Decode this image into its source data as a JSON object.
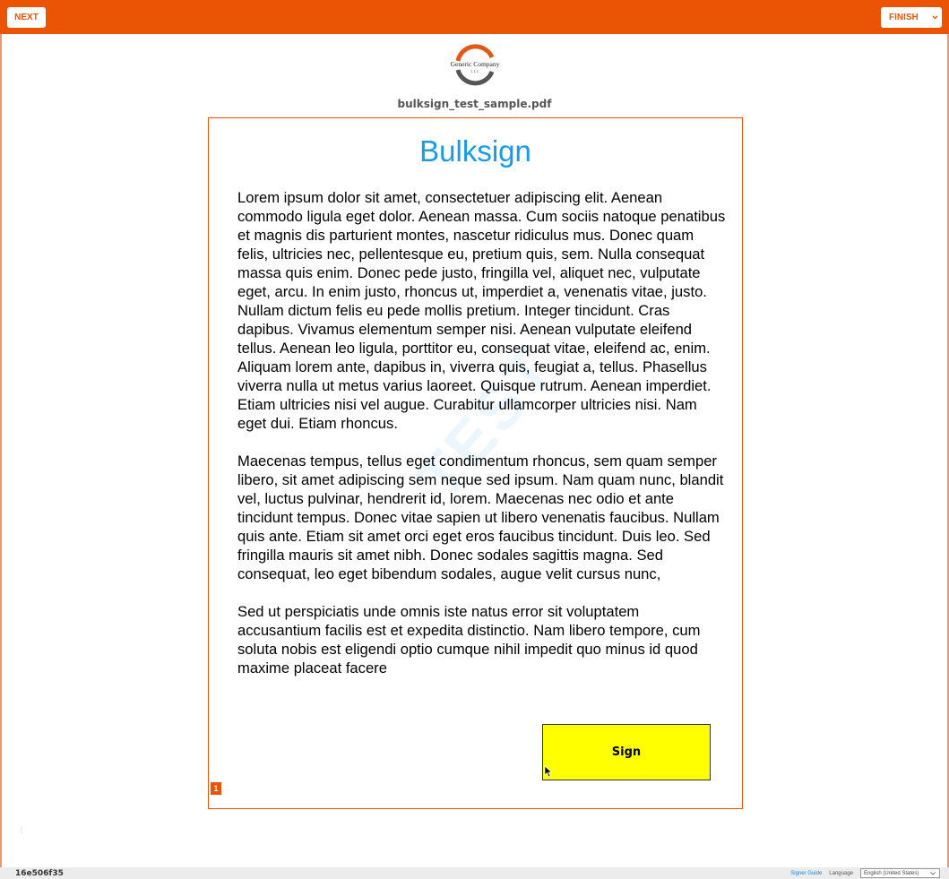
{
  "toolbar": {
    "next_label": "NEXT",
    "finish_label": "FINISH",
    "accent_color": "#ea5404"
  },
  "logo": {
    "text_line1": "Generic Company",
    "text_line2": "L L C"
  },
  "document": {
    "filename": "bulksign_test_sample.pdf",
    "title": "Bulksign",
    "paragraphs": [
      "Lorem ipsum dolor sit amet, consectetuer adipiscing elit. Aenean commodo ligula eget dolor. Aenean massa. Cum sociis natoque penatibus et magnis dis parturient montes, nascetur ridiculus mus. Donec quam felis, ultricies nec, pellentesque eu, pretium quis, sem. Nulla consequat massa quis enim. Donec pede justo, fringilla vel, aliquet nec, vulputate eget, arcu. In enim justo, rhoncus ut, imperdiet a, venenatis vitae, justo. Nullam dictum felis eu pede mollis pretium. Integer tincidunt. Cras dapibus. Vivamus elementum semper nisi. Aenean vulputate eleifend tellus. Aenean leo ligula, porttitor eu, consequat vitae, eleifend ac, enim. Aliquam lorem ante, dapibus in, viverra quis, feugiat a, tellus. Phasellus viverra nulla ut metus varius laoreet. Quisque rutrum. Aenean imperdiet. Etiam ultricies nisi vel augue. Curabitur ullamcorper ultricies nisi. Nam eget dui. Etiam rhoncus.",
      "Maecenas tempus, tellus eget condimentum rhoncus, sem quam semper libero, sit amet adipiscing sem neque sed ipsum. Nam quam nunc, blandit vel, luctus pulvinar, hendrerit id, lorem. Maecenas nec odio et ante tincidunt tempus. Donec vitae sapien ut libero venenatis faucibus. Nullam quis ante. Etiam sit amet orci eget eros faucibus tincidunt. Duis leo. Sed fringilla mauris sit amet nibh. Donec sodales sagittis magna. Sed consequat, leo eget bibendum sodales, augue velit cursus nunc,",
      "Sed ut perspiciatis unde omnis iste natus error sit voluptatem accusantium facilis est et expedita distinctio. Nam libero tempore, cum soluta nobis est eligendi optio cumque nihil impedit quo minus id quod maxime placeat facere"
    ],
    "watermark": "TEST",
    "sign_label": "Sign",
    "sign_color": "#ffff00",
    "page_number": "1"
  },
  "footer": {
    "transaction_id": "16e506f35",
    "signer_guide": "Signer Guide",
    "language_label": "Language",
    "language_value": "English (United States)"
  }
}
